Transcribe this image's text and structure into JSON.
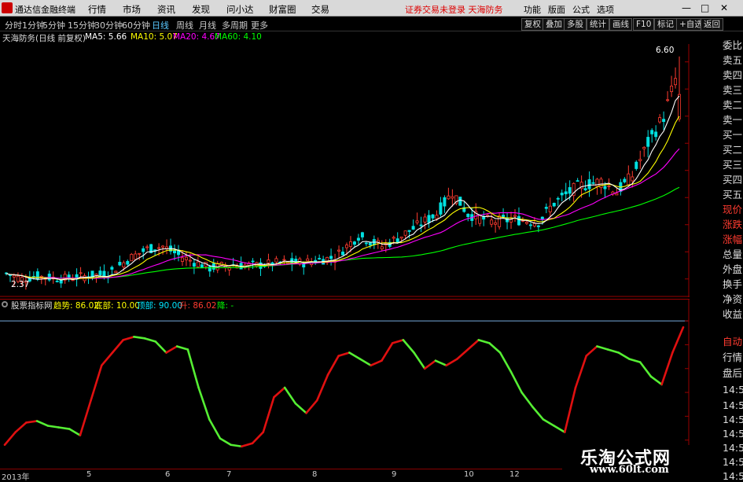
{
  "topbar": {
    "app_title": "通达信金融终端",
    "menu": [
      "行情",
      "市场",
      "资讯",
      "发现",
      "问小达",
      "财富圈",
      "交易"
    ],
    "status": "证券交易未登录 天海防务",
    "tools": [
      "功能",
      "版面",
      "公式",
      "选项"
    ],
    "window_buttons": [
      "—",
      "□",
      "✕"
    ]
  },
  "tabbar": {
    "periods": [
      "分时",
      "1分钟",
      "5分钟",
      "15分钟",
      "30分钟",
      "60分钟",
      "日线",
      "周线",
      "月线",
      "多周期",
      "更多"
    ],
    "active": "日线",
    "right_buttons": [
      "复权",
      "叠加",
      "多股",
      "统计",
      "画线",
      "F10",
      "标记",
      "+自选",
      "返回"
    ]
  },
  "main_header": {
    "title": "天海防务(日线 前复权)",
    "ma5": "MA5: 5.66",
    "ma10": "MA10: 5.07",
    "ma20": "MA20: 4.67",
    "ma60": "MA60: 4.10"
  },
  "indicator_header": {
    "name": "股票指标网",
    "trend": "趋势: 86.02",
    "bottom": "底部: 10.00",
    "top": "顶部: 90.00",
    "up": "升: 86.02",
    "down": "降: -"
  },
  "annotations": {
    "high_label": "6.60",
    "low_label": "2.37"
  },
  "colors": {
    "up": "#ff3b30",
    "down": "#00e0e0",
    "ma5": "#ffffff",
    "ma10": "#ffff00",
    "ma20": "#ff00ff",
    "ma60": "#00ff00",
    "ind_up": "#e01010",
    "ind_down": "#55ee33"
  },
  "right_column": [
    "委比",
    "卖五",
    "卖四",
    "卖三",
    "卖二",
    "卖一",
    "买一",
    "买二",
    "买三",
    "买四",
    "买五",
    "现价",
    "涨跌",
    "涨幅",
    "总量",
    "外盘",
    "换手",
    "净资",
    "收益",
    "自动",
    "行情",
    "盘后",
    "14:50",
    "14:50",
    "14:50",
    "14:50",
    "14:50",
    "14:50",
    "14:50"
  ],
  "x_axis": [
    "2013年",
    "5",
    "6",
    "7",
    "8",
    "9",
    "10",
    "12"
  ],
  "watermark": {
    "line1": "乐淘公式网",
    "line2": "www.60lt.com"
  },
  "chart_data": [
    {
      "type": "candlestick",
      "title": "天海防务(日线 前复权)",
      "y_ticks": [
        2.5,
        3.0,
        3.5,
        4.0,
        4.5,
        5.0,
        5.5,
        6.0,
        6.5
      ],
      "ylim": [
        2.25,
        6.8
      ],
      "x_categories": [
        "2013年",
        "5",
        "6",
        "7",
        "8",
        "9",
        "10",
        "12"
      ],
      "series": [
        {
          "name": "MA5",
          "value": 5.66
        },
        {
          "name": "MA10",
          "value": 5.07
        },
        {
          "name": "MA20",
          "value": 4.67
        },
        {
          "name": "MA60",
          "value": 4.1
        }
      ],
      "close_path": [
        [
          0,
          2.6
        ],
        [
          4,
          2.5
        ],
        [
          8,
          2.55
        ],
        [
          14,
          2.5
        ],
        [
          20,
          2.55
        ],
        [
          26,
          2.6
        ],
        [
          32,
          2.9
        ],
        [
          36,
          3.05
        ],
        [
          40,
          3.1
        ],
        [
          45,
          2.9
        ],
        [
          52,
          2.7
        ],
        [
          56,
          2.75
        ],
        [
          64,
          2.75
        ],
        [
          70,
          2.8
        ],
        [
          76,
          2.8
        ],
        [
          84,
          2.9
        ],
        [
          90,
          3.3
        ],
        [
          96,
          3.1
        ],
        [
          100,
          3.25
        ],
        [
          110,
          3.7
        ],
        [
          114,
          4.1
        ],
        [
          118,
          3.7
        ],
        [
          124,
          3.55
        ],
        [
          130,
          3.6
        ],
        [
          136,
          3.55
        ],
        [
          140,
          3.9
        ],
        [
          146,
          4.2
        ],
        [
          152,
          4.3
        ],
        [
          156,
          4.1
        ],
        [
          160,
          4.4
        ],
        [
          164,
          5.0
        ],
        [
          168,
          5.5
        ],
        [
          172,
          6.4
        ]
      ],
      "high": 6.6,
      "low": 2.37
    },
    {
      "type": "line",
      "title": "股票指标网",
      "y_ticks": [
        15.0,
        30.0,
        45.0,
        60.0,
        75.0,
        90.0
      ],
      "ylim": [
        0,
        95
      ],
      "series": [
        {
          "name": "趋势",
          "values": [
            12,
            20,
            26,
            27,
            24,
            23,
            22,
            18,
            40,
            62,
            70,
            78,
            80,
            79,
            77,
            70,
            74,
            72,
            48,
            28,
            16,
            12,
            11,
            13,
            20,
            42,
            48,
            38,
            32,
            40,
            56,
            68,
            70,
            66,
            62,
            65,
            76,
            78,
            70,
            60,
            65,
            62,
            66,
            72,
            78,
            76,
            70,
            58,
            45,
            36,
            28,
            24,
            20,
            48,
            68,
            74,
            72,
            70,
            66,
            64,
            55,
            50,
            70,
            86
          ]
        }
      ],
      "bottom": 10.0,
      "top": 90.0,
      "last": 86.02
    }
  ]
}
